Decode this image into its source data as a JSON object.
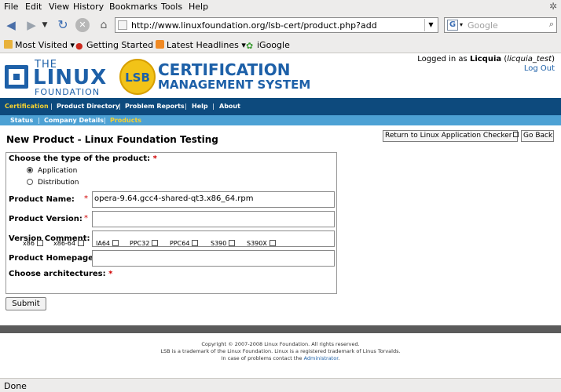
{
  "browser": {
    "menu": [
      "File",
      "Edit",
      "View",
      "History",
      "Bookmarks",
      "Tools",
      "Help"
    ],
    "url": "http://www.linuxfoundation.org/lsb-cert/product.php?add",
    "search_placeholder": "Google",
    "bookmarks": [
      "Most Visited",
      "Getting Started",
      "Latest Headlines",
      "iGoogle"
    ],
    "status": "Done"
  },
  "header": {
    "lf_the": "THE",
    "lf_linux": "LINUX",
    "lf_foundation": "FOUNDATION",
    "lsb_badge": "LSB",
    "lsb_title_1": "CERTIFICATION",
    "lsb_title_2": "MANAGEMENT SYSTEM",
    "login_prefix": "Logged in as",
    "login_user": "Licquia",
    "login_account": "licquia_test",
    "logout": "Log Out"
  },
  "nav_primary": [
    "Certification",
    "Product Directory",
    "Problem Reports",
    "Help",
    "About"
  ],
  "nav_secondary": [
    "Status",
    "Company Details",
    "Products"
  ],
  "page_title": "New Product - Linux Foundation Testing",
  "return_button": "Return to Linux Application Checker",
  "back_button": "Go Back",
  "form": {
    "type_label": "Choose the type of the product:",
    "type_options": [
      "Application",
      "Distribution"
    ],
    "selected_type": "Application",
    "product_name_label": "Product Name:",
    "product_name_value": "opera-9.64.gcc4-shared-qt3.x86_64.rpm",
    "product_version_label": "Product Version:",
    "version_comment_label": "Version Comment:",
    "product_homepage_label": "Product Homepage:",
    "arch_label": "Choose architectures:",
    "architectures": [
      "x86",
      "x86-64",
      "IA64",
      "PPC32",
      "PPC64",
      "S390",
      "S390X"
    ],
    "required_mark": "*",
    "submit": "Submit"
  },
  "footer": {
    "line1": "Copyright © 2007-2008 Linux Foundation. All rights reserved.",
    "line2": "LSB is a trademark of the Linux Foundation. Linux is a registered trademark of Linus Torvalds.",
    "line3_prefix": "In case of problems contact the",
    "line3_link": "Administrator",
    "line3_suffix": "."
  }
}
